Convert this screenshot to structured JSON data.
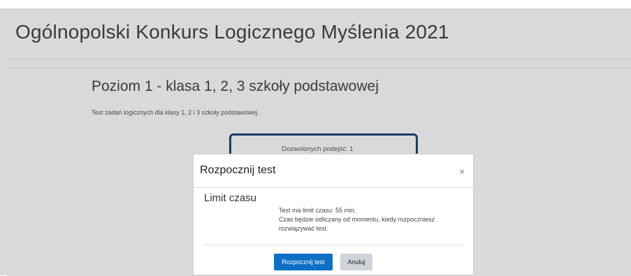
{
  "header": {
    "title": "Ogólnopolski Konkurs Logicznego Myślenia 2021"
  },
  "quiz": {
    "title": "Poziom 1 - klasa 1, 2, 3 szkoły podstawowej",
    "description": "Test zadań logicznych dla klasy 1, 2 i 3 szkoły podstawowej.",
    "attempts_allowed": "Dozwolonych podejść: 1"
  },
  "modal": {
    "title": "Rozpocznij test",
    "close_glyph": "×",
    "section_label": "Limit czasu",
    "info_lines": [
      "Test ma limit czasu: 55 min.",
      "Czas będzie odliczany od momentu, kiedy rozpoczniesz rozwiązywać test."
    ],
    "start_button": "Rozpocznij test",
    "cancel_button": "Anuluj"
  },
  "colors": {
    "primary": "#0f6fc5",
    "secondary": "#ced4da",
    "backdrop": "#d9d9d9",
    "attempts_border": "#1a3a6b"
  }
}
